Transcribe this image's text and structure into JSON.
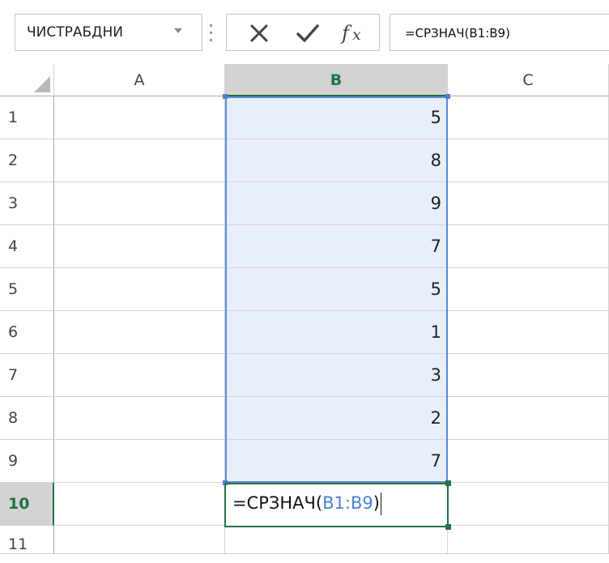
{
  "name_box": {
    "value": "ЧИСТРАБДНИ"
  },
  "formula_bar": {
    "value": "=СРЗНАЧ(B1:B9)"
  },
  "columns": [
    "A",
    "B",
    "C"
  ],
  "selected_column": "B",
  "rows": [
    "1",
    "2",
    "3",
    "4",
    "5",
    "6",
    "7",
    "8",
    "9",
    "10",
    "11"
  ],
  "selected_row": "10",
  "column_b_values": [
    "5",
    "8",
    "9",
    "7",
    "5",
    "1",
    "3",
    "2",
    "7"
  ],
  "editing_cell": {
    "prefix": "=СРЗНАЧ(",
    "range": "B1:B9",
    "suffix": ")"
  },
  "colors": {
    "accent": "#217346",
    "range": "#5b8bd8",
    "range_fill": "#e8eefa"
  }
}
